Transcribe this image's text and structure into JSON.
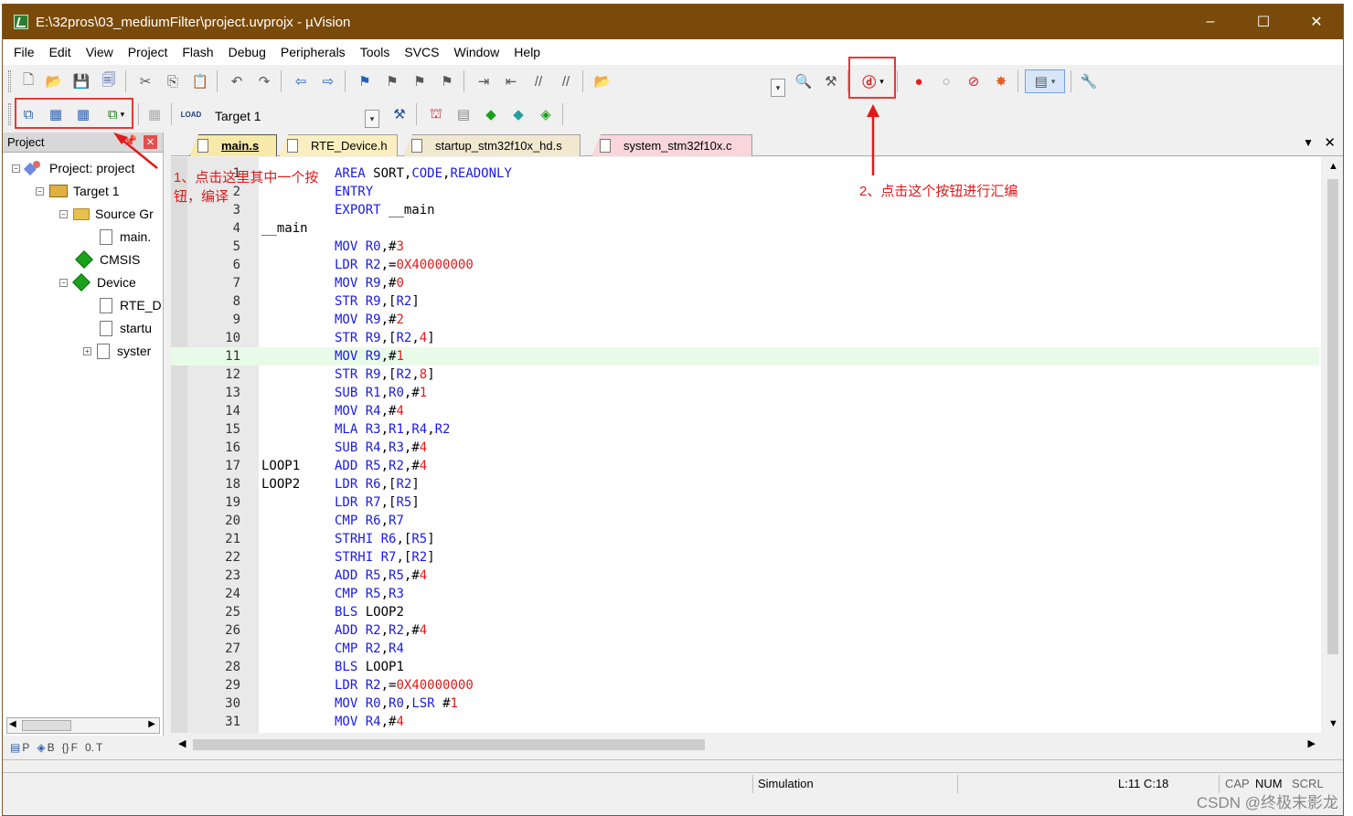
{
  "window": {
    "title": "E:\\32pros\\03_mediumFilter\\project.uvprojx - µVision",
    "minimize": "–",
    "maximize": "☐",
    "close": "✕"
  },
  "menu": [
    "File",
    "Edit",
    "View",
    "Project",
    "Flash",
    "Debug",
    "Peripherals",
    "Tools",
    "SVCS",
    "Window",
    "Help"
  ],
  "toolbar2": {
    "target_label": "Target 1"
  },
  "project_pane": {
    "header": "Project",
    "tree": [
      {
        "label": "Project: project"
      },
      {
        "label": "Target 1"
      },
      {
        "label": "Source Gr"
      },
      {
        "label": "main."
      },
      {
        "label": "CMSIS"
      },
      {
        "label": "Device"
      },
      {
        "label": "RTE_D"
      },
      {
        "label": "startu"
      },
      {
        "label": "syster"
      }
    ],
    "bottom_tabs": [
      "P",
      "B",
      "F",
      "T"
    ]
  },
  "editor_tabs": [
    {
      "label": "main.s",
      "active": true,
      "color": "#f7e9a8"
    },
    {
      "label": "RTE_Device.h",
      "active": false,
      "color": "#fbeec0"
    },
    {
      "label": "startup_stm32f10x_hd.s",
      "active": false,
      "color": "#f1e8d0"
    },
    {
      "label": "system_stm32f10x.c",
      "active": false,
      "color": "#f8d6dc"
    }
  ],
  "code": {
    "highlight_line": 11,
    "lines": [
      {
        "n": "1",
        "label": "",
        "code": "AREA SORT,CODE,READONLY"
      },
      {
        "n": "2",
        "label": "",
        "code": "ENTRY"
      },
      {
        "n": "3",
        "label": "",
        "code": "EXPORT __main"
      },
      {
        "n": "4",
        "label": "__main",
        "code": ""
      },
      {
        "n": "5",
        "label": "",
        "code": "MOV R0,#3"
      },
      {
        "n": "6",
        "label": "",
        "code": "LDR R2,=0X40000000"
      },
      {
        "n": "7",
        "label": "",
        "code": "MOV R9,#0"
      },
      {
        "n": "8",
        "label": "",
        "code": "STR R9,[R2]"
      },
      {
        "n": "9",
        "label": "",
        "code": "MOV R9,#2"
      },
      {
        "n": "10",
        "label": "",
        "code": "STR R9,[R2,4]"
      },
      {
        "n": "11",
        "label": "",
        "code": "MOV R9,#1"
      },
      {
        "n": "12",
        "label": "",
        "code": "STR R9,[R2,8]"
      },
      {
        "n": "13",
        "label": "",
        "code": "SUB R1,R0,#1"
      },
      {
        "n": "14",
        "label": "",
        "code": "MOV R4,#4"
      },
      {
        "n": "15",
        "label": "",
        "code": "MLA R3,R1,R4,R2"
      },
      {
        "n": "16",
        "label": "",
        "code": "SUB R4,R3,#4"
      },
      {
        "n": "17",
        "label": "LOOP1",
        "code": "ADD R5,R2,#4"
      },
      {
        "n": "18",
        "label": "LOOP2",
        "code": "LDR R6,[R2]"
      },
      {
        "n": "19",
        "label": "",
        "code": "LDR R7,[R5]"
      },
      {
        "n": "20",
        "label": "",
        "code": "CMP R6,R7"
      },
      {
        "n": "21",
        "label": "",
        "code": "STRHI R6,[R5]"
      },
      {
        "n": "22",
        "label": "",
        "code": "STRHI R7,[R2]"
      },
      {
        "n": "23",
        "label": "",
        "code": "ADD R5,R5,#4"
      },
      {
        "n": "24",
        "label": "",
        "code": "CMP R5,R3"
      },
      {
        "n": "25",
        "label": "",
        "code": "BLS LOOP2"
      },
      {
        "n": "26",
        "label": "",
        "code": "ADD R2,R2,#4"
      },
      {
        "n": "27",
        "label": "",
        "code": "CMP R2,R4"
      },
      {
        "n": "28",
        "label": "",
        "code": "BLS LOOP1"
      },
      {
        "n": "29",
        "label": "",
        "code": "LDR R2,=0X40000000"
      },
      {
        "n": "30",
        "label": "",
        "code": "MOV R0,R0,LSR #1"
      },
      {
        "n": "31",
        "label": "",
        "code": "MOV R4,#4"
      }
    ]
  },
  "status": {
    "mode": "Simulation",
    "position": "L:11 C:18",
    "cap": "CAP",
    "num": "NUM",
    "scrl": "SCRL"
  },
  "annotations": {
    "note1": "1、点击这里其中一个按钮，编译",
    "note2": "2、点击这个按钮进行汇编"
  },
  "watermark": "CSDN @终极末影龙",
  "colors": {
    "titlebar": "#7a4a0a",
    "annotation": "#e01a1a",
    "highlight": "#e8fbe8"
  }
}
